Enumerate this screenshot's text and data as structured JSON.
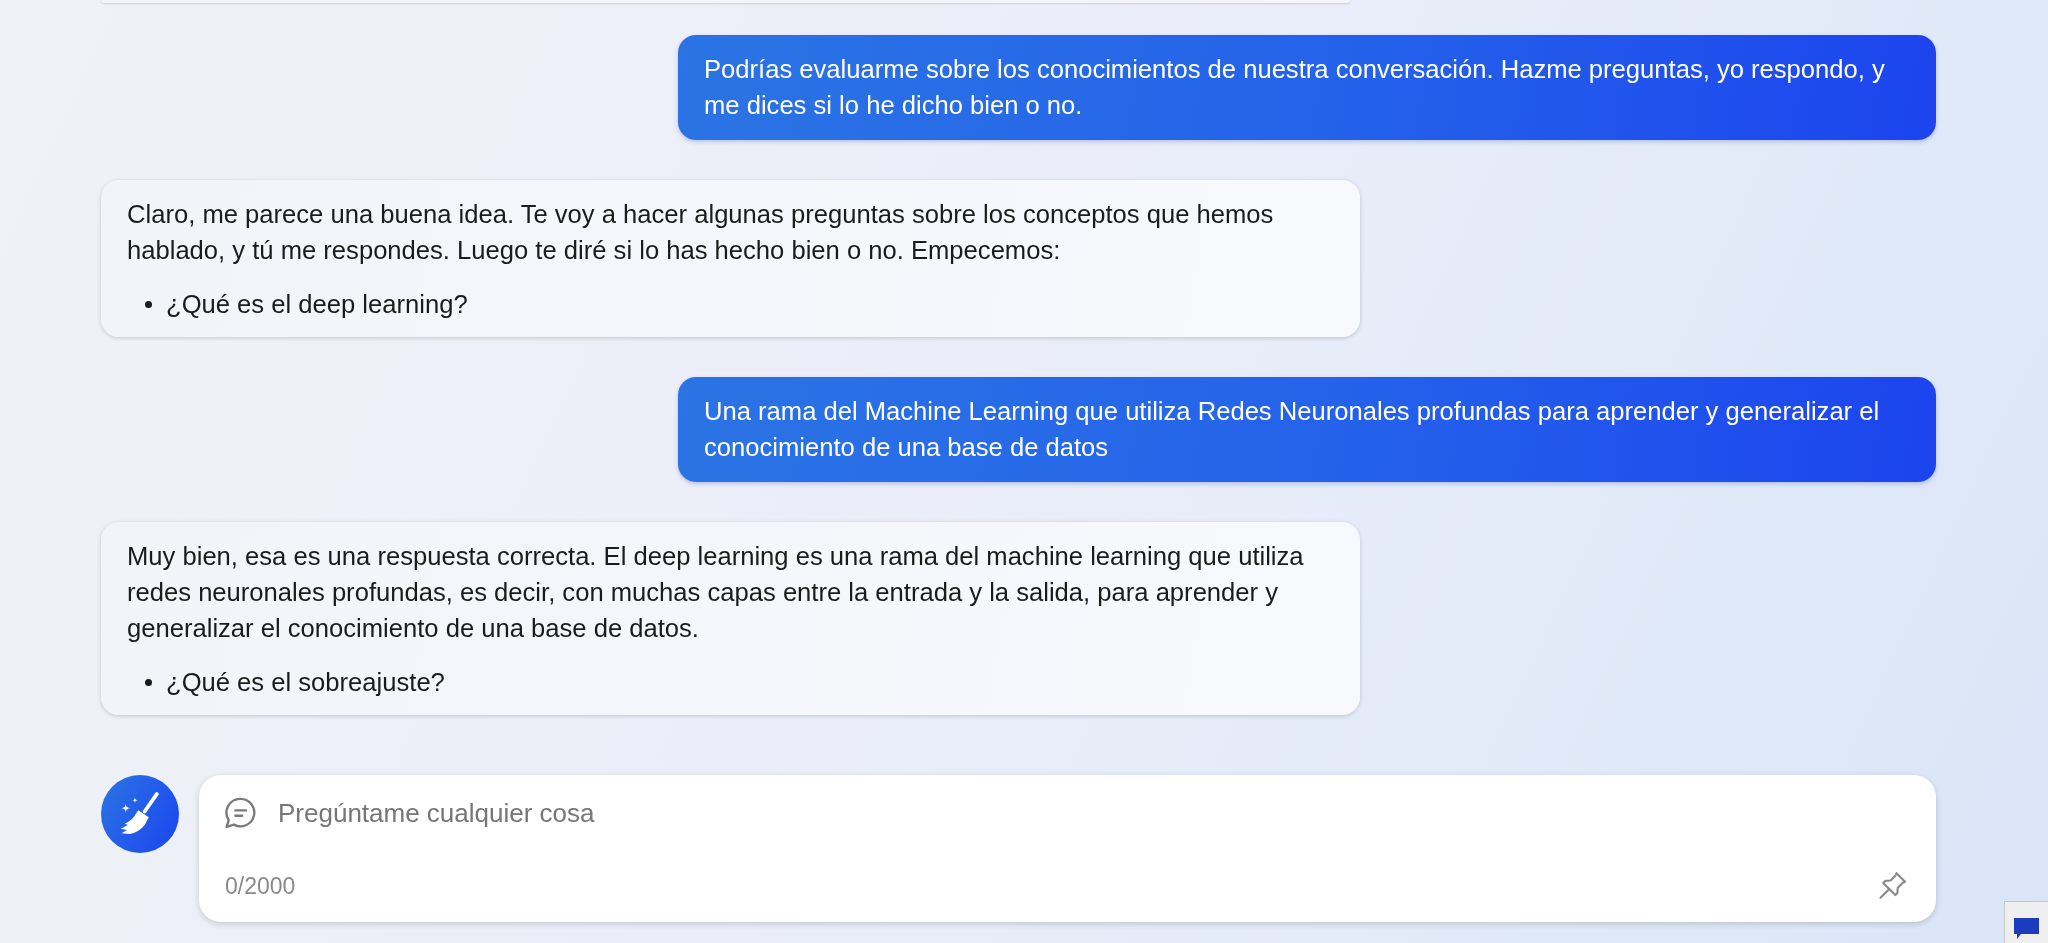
{
  "conversation": {
    "messages": [
      {
        "kind": "user",
        "text": "Podrías evaluarme sobre los conocimientos de nuestra conversación. Hazme preguntas, yo respondo, y me dices si lo he dicho bien o no."
      },
      {
        "kind": "bot",
        "text": "Claro, me parece una buena idea. Te voy a hacer algunas preguntas sobre los conceptos que hemos hablado, y tú me respondes. Luego te diré si lo has hecho bien o no. Empecemos:",
        "bullets": [
          "¿Qué es el deep learning?"
        ]
      },
      {
        "kind": "user",
        "text": "Una rama del Machine Learning que utiliza Redes Neuronales profundas para aprender y generalizar el conocimiento de una base de datos"
      },
      {
        "kind": "bot",
        "text": "Muy bien, esa es una respuesta correcta. El deep learning es una rama del machine learning que utiliza redes neuronales profundas, es decir, con muchas capas entre la entrada y la salida, para aprender y generalizar el conocimiento de una base de datos.",
        "bullets": [
          "¿Qué es el sobreajuste?"
        ]
      }
    ]
  },
  "composer": {
    "placeholder": "Pregúntame cualquier cosa",
    "counter": "0/2000"
  }
}
